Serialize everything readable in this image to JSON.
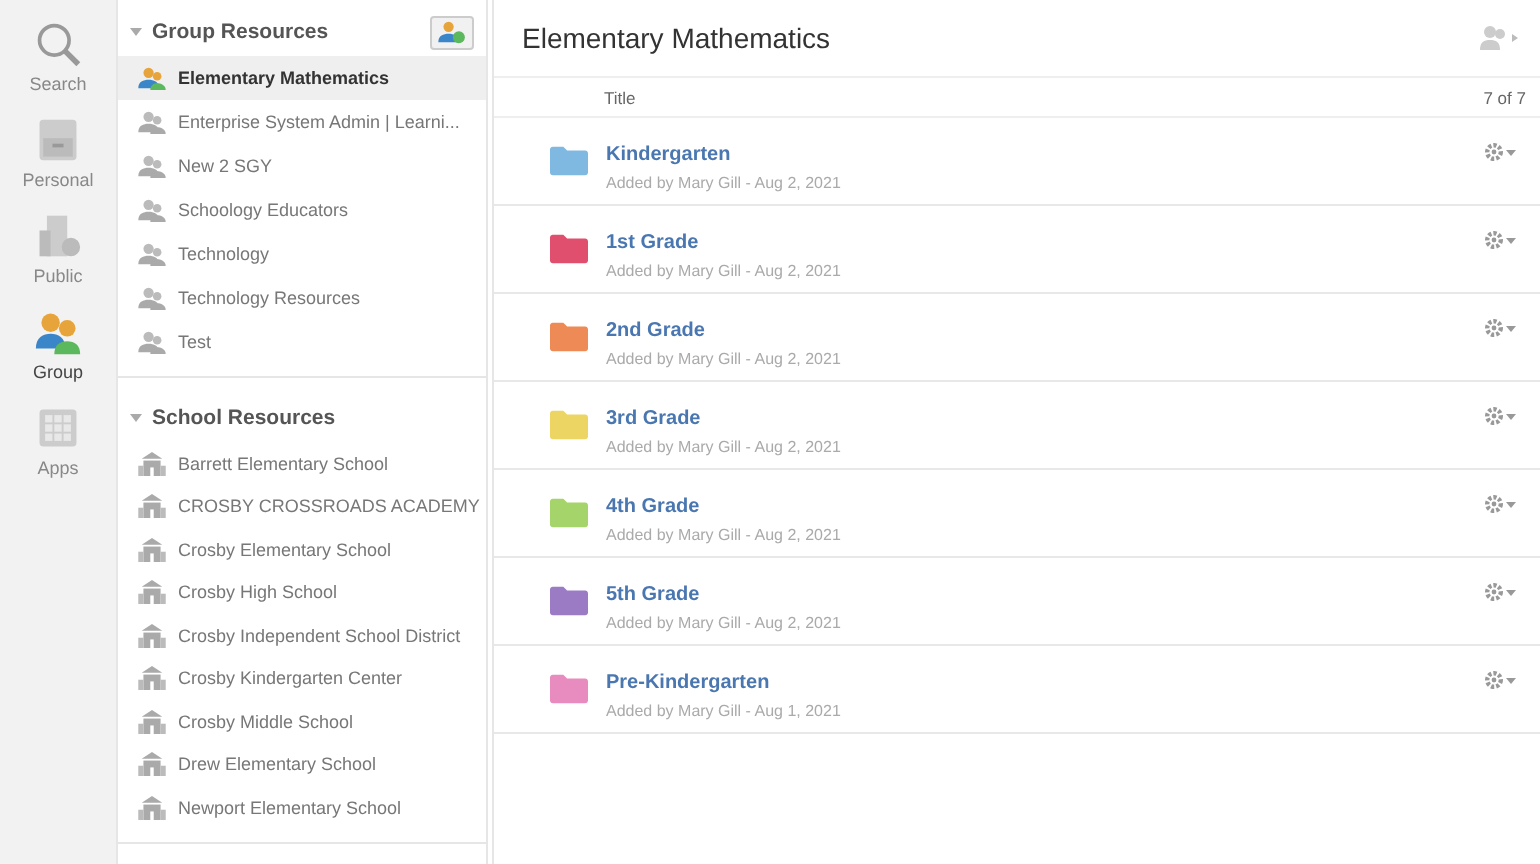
{
  "rail": [
    {
      "label": "Search",
      "kind": "search",
      "selected": false
    },
    {
      "label": "Personal",
      "kind": "personal",
      "selected": false
    },
    {
      "label": "Public",
      "kind": "public",
      "selected": false
    },
    {
      "label": "Group",
      "kind": "group",
      "selected": true
    },
    {
      "label": "Apps",
      "kind": "apps",
      "selected": false
    }
  ],
  "sections": [
    {
      "title": "Group Resources",
      "expanded": true,
      "kind": "group",
      "has_add": true,
      "items": [
        {
          "label": "Elementary Mathematics",
          "selected": true
        },
        {
          "label": "Enterprise System Admin | Learni...",
          "selected": false
        },
        {
          "label": "New 2 SGY",
          "selected": false
        },
        {
          "label": "Schoology Educators",
          "selected": false
        },
        {
          "label": "Technology",
          "selected": false
        },
        {
          "label": "Technology Resources",
          "selected": false
        },
        {
          "label": "Test",
          "selected": false
        }
      ]
    },
    {
      "title": "School Resources",
      "expanded": true,
      "kind": "school",
      "has_add": false,
      "items": [
        {
          "label": "Barrett Elementary School",
          "selected": false
        },
        {
          "label": "CROSBY CROSSROADS ACADEMY",
          "selected": false
        },
        {
          "label": "Crosby Elementary School",
          "selected": false
        },
        {
          "label": "Crosby High School",
          "selected": false
        },
        {
          "label": "Crosby Independent School District",
          "selected": false
        },
        {
          "label": "Crosby Kindergarten Center",
          "selected": false
        },
        {
          "label": "Crosby Middle School",
          "selected": false
        },
        {
          "label": "Drew Elementary School",
          "selected": false
        },
        {
          "label": "Newport Elementary School",
          "selected": false
        }
      ]
    }
  ],
  "main": {
    "title": "Elementary Mathematics",
    "column": "Title",
    "count": "7 of 7",
    "folders": [
      {
        "title": "Kindergarten",
        "meta": "Added by Mary Gill - Aug 2, 2021",
        "color": "#7fb8e0"
      },
      {
        "title": "1st Grade",
        "meta": "Added by Mary Gill - Aug 2, 2021",
        "color": "#e0506e"
      },
      {
        "title": "2nd Grade",
        "meta": "Added by Mary Gill - Aug 2, 2021",
        "color": "#ee8a55"
      },
      {
        "title": "3rd Grade",
        "meta": "Added by Mary Gill - Aug 2, 2021",
        "color": "#ecd562"
      },
      {
        "title": "4th Grade",
        "meta": "Added by Mary Gill - Aug 2, 2021",
        "color": "#a5d46a"
      },
      {
        "title": "5th Grade",
        "meta": "Added by Mary Gill - Aug 2, 2021",
        "color": "#9b7bc4"
      },
      {
        "title": "Pre-Kindergarten",
        "meta": "Added by Mary Gill - Aug 1, 2021",
        "color": "#e88cbf"
      }
    ]
  }
}
